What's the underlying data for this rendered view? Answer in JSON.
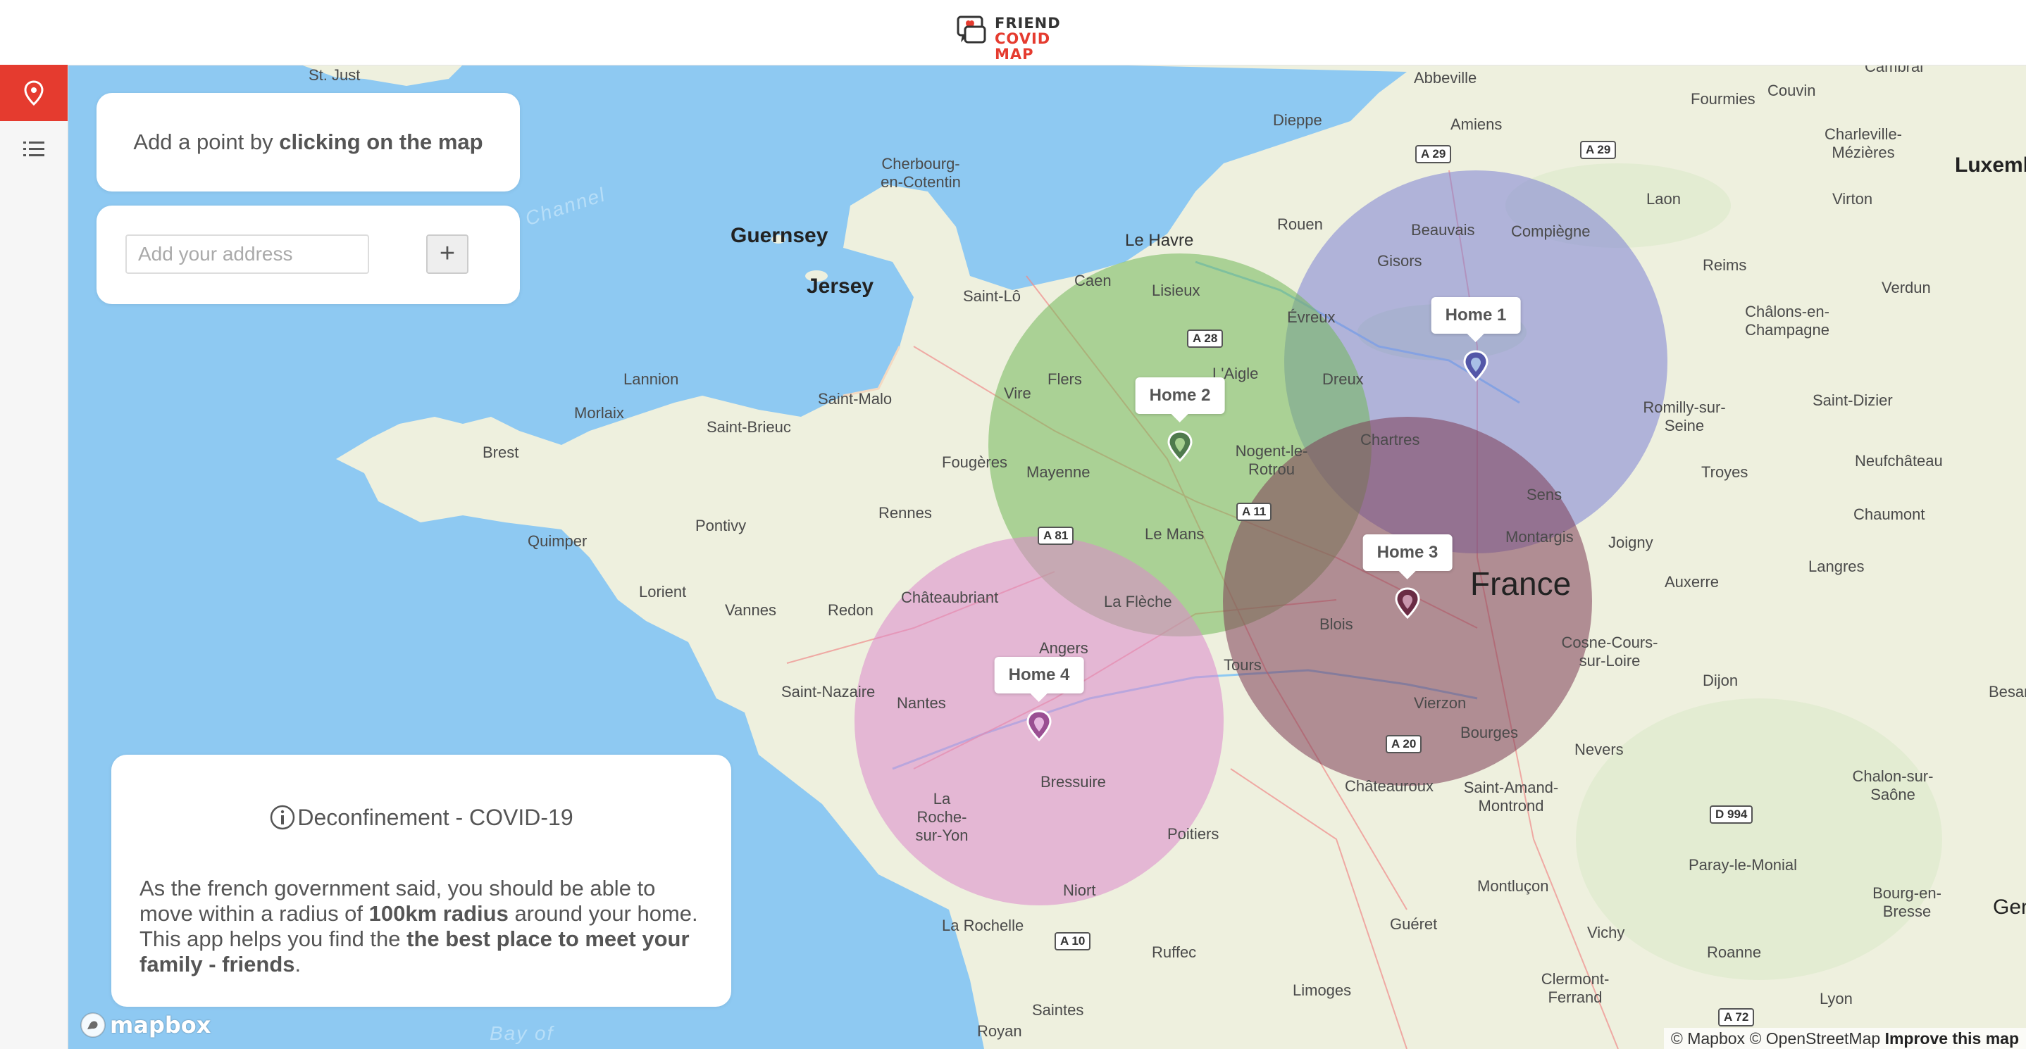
{
  "app": {
    "logo_line1": "FRIEND",
    "logo_line2": "COVID MAP"
  },
  "colors": {
    "accent": "#e53b2f",
    "water": "#8ec9f2",
    "land": "#eef0de"
  },
  "sidebar": {
    "items": [
      {
        "icon": "map-pin-icon",
        "active": true
      },
      {
        "icon": "list-icon",
        "active": false
      }
    ]
  },
  "hint": {
    "prefix": "Add a point by ",
    "bold": "clicking on the map"
  },
  "address": {
    "placeholder": "Add your address",
    "add_label": "+"
  },
  "info": {
    "title": "Deconfinement - COVID-19",
    "p1": "As the french government said, you should be able to move within a radius of ",
    "b1": "100km radius",
    "p2": " around your home. This app helps you find the ",
    "b2": "the best place to meet your family - friends",
    "p3": "."
  },
  "homes": [
    {
      "label": "Home 1",
      "color": "#6f73c7"
    },
    {
      "label": "Home 2",
      "color": "#5fae5a"
    },
    {
      "label": "Home 3",
      "color": "#7d3d55"
    },
    {
      "label": "Home 4",
      "color": "#c86bbd"
    }
  ],
  "map": {
    "country": "France",
    "places": [
      "St. Just",
      "Abbeville",
      "Cambrai",
      "Fourmies",
      "Couvin",
      "Amiens",
      "Dieppe",
      "Charleville-Mézières",
      "Cherbourg-en-Cotentin",
      "Luxemb",
      "Laon",
      "Virton",
      "Le Havre",
      "Rouen",
      "Beauvais",
      "Compiègne",
      "Guernsey",
      "Jersey",
      "Saint-Lô",
      "Caen",
      "Lisieux",
      "Gisors",
      "Reims",
      "Évreux",
      "Châlons-en-Champagne",
      "Verdun",
      "Vire",
      "Flers",
      "L'Aigle",
      "Dreux",
      "Lannion",
      "Saint-Malo",
      "Morlaix",
      "Saint-Brieuc",
      "Romilly-sur-Seine",
      "Saint-Dizier",
      "Brest",
      "Chartres",
      "Nogent-le-Rotrou",
      "Fougères",
      "Mayenne",
      "Troyes",
      "Neufchâteau",
      "Pontivy",
      "Rennes",
      "Sens",
      "Chaumont",
      "Quimper",
      "Le Mans",
      "Montargis",
      "Joigny",
      "Lorient",
      "Vannes",
      "Redon",
      "Châteaubriant",
      "La Flèche",
      "Langres",
      "Auxerre",
      "Angers",
      "Blois",
      "Cosne-Cours-sur-Loire",
      "Saint-Nazaire",
      "Nantes",
      "Tours",
      "Dijon",
      "Vierzon",
      "Bourges",
      "Nevers",
      "Bressuire",
      "La Roche-sur-Yon",
      "Poitiers",
      "Châteauroux",
      "Saint-Amand-Montrond",
      "Chalon-sur-Saône",
      "Niort",
      "Paray-le-Monial",
      "Montluçon",
      "Bourg-en-Bresse",
      "La Rochelle",
      "Guéret",
      "Vichy",
      "Roanne",
      "Ruffec",
      "Limoges",
      "Clermont-Ferrand",
      "Saintes",
      "Royan",
      "Lyon",
      "Besanç",
      "Gen",
      "Bay of",
      "n Channel"
    ],
    "roads": [
      "A 29",
      "A 29",
      "A 28",
      "A 81",
      "A 11",
      "A 20",
      "A 10",
      "D 994",
      "A 72"
    ]
  },
  "attribution": {
    "a": "© Mapbox",
    "b": "© OpenStreetMap",
    "c": "Improve this map"
  },
  "mapbox": "mapbox"
}
